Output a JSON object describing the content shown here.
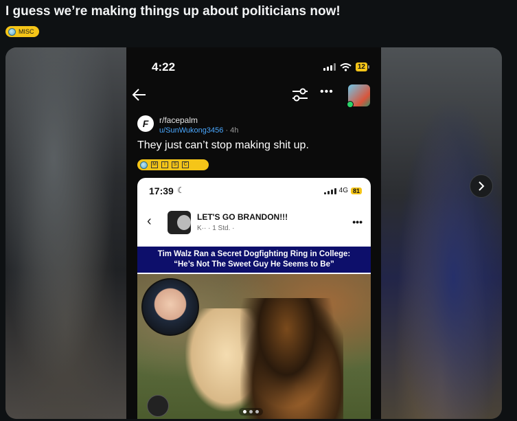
{
  "post": {
    "title": "I guess we’re making things up about politicians now!",
    "flair": "MISC"
  },
  "gallery": {
    "next_icon": "chevron-right-icon",
    "screenshot": {
      "status_time": "4:22",
      "battery": "12",
      "subreddit": "r/facepalm",
      "author": "u/SunWukong3456",
      "age": "4h",
      "title": "They just can’t stop making shit up.",
      "flair_letters": [
        "M",
        "I",
        "S",
        "C"
      ],
      "embedded": {
        "status_time": "17:39",
        "network": "4G",
        "battery": "81",
        "page_name": "LET'S GO BRANDON!!!",
        "page_meta": "K··  · 1 Std. ·",
        "headline_line1": "Tim Walz Ran a Secret Dogfighting Ring in College:",
        "headline_line2": "“He’s Not The Sweet Guy He Seems to Be”"
      }
    }
  }
}
